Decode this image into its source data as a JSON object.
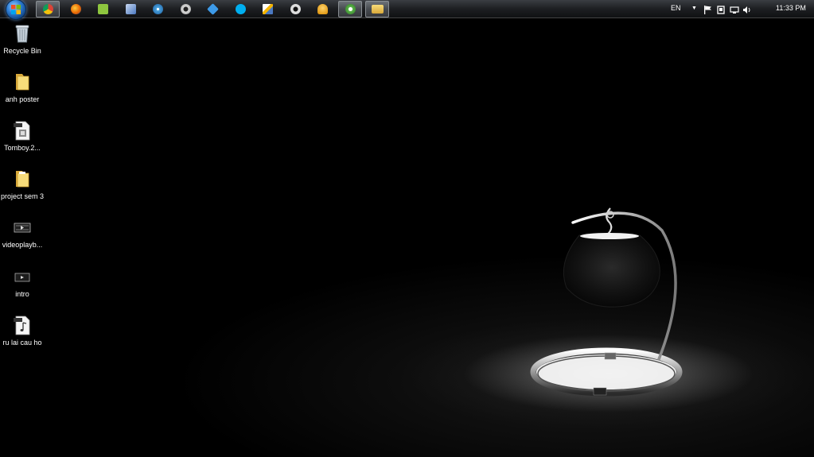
{
  "taskbar": {
    "apps": [
      {
        "name": "chrome",
        "active": true
      },
      {
        "name": "firefox",
        "active": false
      },
      {
        "name": "utility",
        "active": false
      },
      {
        "name": "tool",
        "active": false
      },
      {
        "name": "disc",
        "active": false
      },
      {
        "name": "camera",
        "active": false
      },
      {
        "name": "dropbox",
        "active": false
      },
      {
        "name": "skype",
        "active": false
      },
      {
        "name": "notepad",
        "active": false
      },
      {
        "name": "settings",
        "active": false
      },
      {
        "name": "bell",
        "active": false
      },
      {
        "name": "utorrent",
        "active": true
      },
      {
        "name": "explorer",
        "active": true
      }
    ],
    "tray": {
      "language": "EN",
      "time": "11:33 PM"
    }
  },
  "desktop_icons": [
    {
      "label": "Recycle Bin",
      "icon": "recycle-bin-icon"
    },
    {
      "label": "anh poster",
      "icon": "folder-icon"
    },
    {
      "label": "Tomboy.2...",
      "icon": "media-file-icon"
    },
    {
      "label": "project sem 3",
      "icon": "folder-icon"
    },
    {
      "label": "videoplayb...",
      "icon": "video-file-icon"
    },
    {
      "label": "intro",
      "icon": "video-file-icon"
    },
    {
      "label": "ru lai cau ho",
      "icon": "audio-file-icon"
    }
  ],
  "colors": {
    "taskbar": "#1d1f22",
    "desktop_background": "#000000",
    "folder": "#e8c24a"
  }
}
